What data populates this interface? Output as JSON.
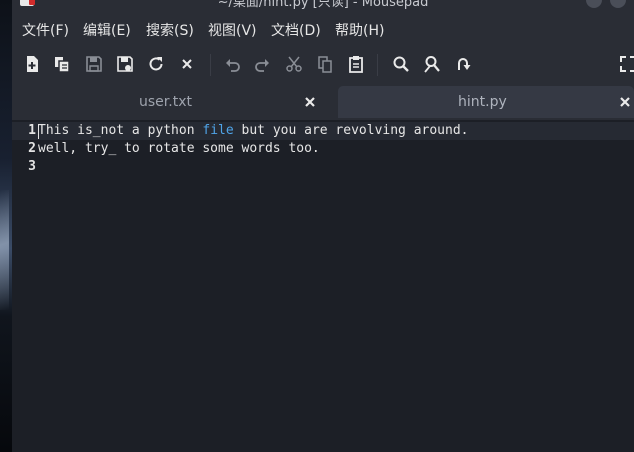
{
  "window": {
    "title": "~/桌面/hint.py [只读] - Mousepad"
  },
  "menu": [
    {
      "label": "文件(F)"
    },
    {
      "label": "编辑(E)"
    },
    {
      "label": "搜索(S)"
    },
    {
      "label": "视图(V)"
    },
    {
      "label": "文档(D)"
    },
    {
      "label": "帮助(H)"
    }
  ],
  "toolbar": {
    "icons": [
      "new-document-icon",
      "new-window-icon",
      "save-icon",
      "save-as-icon",
      "reload-icon",
      "close-icon",
      "undo-icon",
      "redo-icon",
      "cut-icon",
      "copy-icon",
      "paste-icon",
      "search-icon",
      "find-replace-icon",
      "go-to-icon",
      "fullscreen-icon"
    ]
  },
  "tabs": [
    {
      "label": "user.txt",
      "active": false
    },
    {
      "label": "hint.py",
      "active": true
    }
  ],
  "editor": {
    "line_numbers": [
      "1",
      "2",
      "3"
    ],
    "lines": [
      {
        "before": "This is_not a python ",
        "keyword": "file",
        "after": " but you are revolving around."
      },
      {
        "before": "well, try_ to rotate some words too.",
        "keyword": "",
        "after": ""
      },
      {
        "before": "",
        "keyword": "",
        "after": ""
      }
    ]
  },
  "colors": {
    "background": "#1c1f26",
    "chrome": "#2a2d35",
    "active_tab": "#353944",
    "keyword": "#4fa4e8",
    "text": "#e6e6e6"
  }
}
